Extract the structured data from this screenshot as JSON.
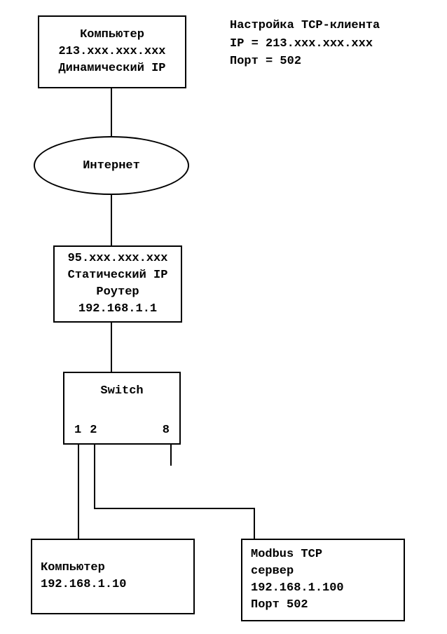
{
  "annotation": {
    "title": "Настройка TCP-клиента",
    "ip_label": "IP = 213.xxx.xxx.xxx",
    "port_label": "Порт = 502"
  },
  "computer_top": {
    "name": "Компьютер",
    "ip": "213.xxx.xxx.xxx",
    "ip_type": "Динамический IP"
  },
  "internet": {
    "label": "Интернет"
  },
  "router": {
    "external_ip": "95.xxx.xxx.xxx",
    "ip_type": "Статический IP",
    "name": "Роутер",
    "internal_ip": "192.168.1.1"
  },
  "switch": {
    "name": "Switch",
    "port1": "1",
    "port2": "2",
    "port8": "8"
  },
  "computer_bottom": {
    "name": "Компьютер",
    "ip": "192.168.1.10"
  },
  "modbus": {
    "name": "Modbus TCP",
    "role": "сервер",
    "ip": "192.168.1.100",
    "port": "Порт 502"
  }
}
